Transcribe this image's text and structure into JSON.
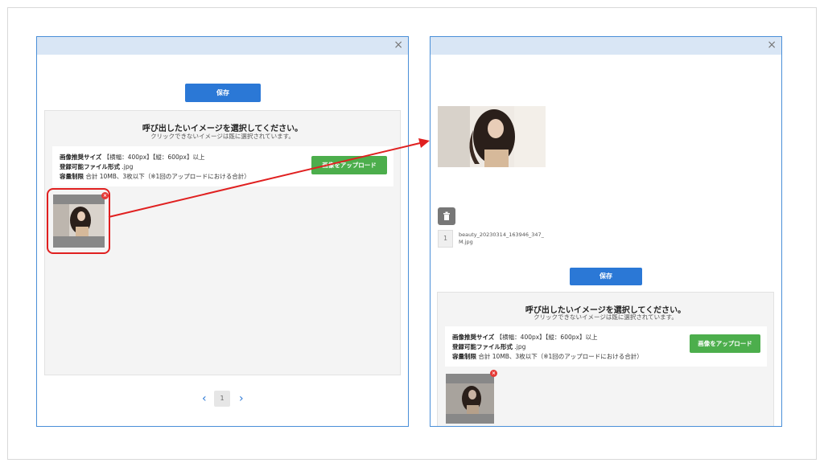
{
  "left_modal": {
    "close_label": "×",
    "save_label": "保存",
    "panel_title": "呼び出したいイメージを選択してください。",
    "panel_subtitle": "クリックできないイメージは既に選択されています。",
    "info": {
      "size_label": "画像推奨サイズ",
      "size_value": "【横幅：400px】【縦：600px】以上",
      "format_label": "登録可能ファイル形式",
      "format_value": ".jpg",
      "limit_label": "容量制限",
      "limit_value": "合計 10MB、3枚以下（※1回のアップロードにおける合計）"
    },
    "upload_label": "画像をアップロード",
    "pager": {
      "prev": "‹",
      "current": "1",
      "next": "›"
    }
  },
  "right_modal": {
    "close_label": "×",
    "file_index": "1",
    "file_name": "beauty_20230314_163946_347_M.jpg",
    "save_label": "保存",
    "panel_title": "呼び出したいイメージを選択してください。",
    "panel_subtitle": "クリックできないイメージは既に選択されています。",
    "info": {
      "size_label": "画像推奨サイズ",
      "size_value": "【横幅：400px】【縦：600px】以上",
      "format_label": "登録可能ファイル形式",
      "format_value": ".jpg",
      "limit_label": "容量制限",
      "limit_value": "合計 10MB、3枚以下（※1回のアップロードにおける合計）"
    },
    "upload_label": "画像をアップロード"
  },
  "colors": {
    "primary": "#2b78d6",
    "upload": "#4cae4c",
    "header": "#d9e6f5",
    "annotation": "#e02020",
    "remove": "#e53935"
  },
  "icons": [
    "close-icon",
    "remove-icon",
    "trash-icon",
    "chevron-left-icon",
    "chevron-right-icon",
    "annotation-arrow"
  ]
}
